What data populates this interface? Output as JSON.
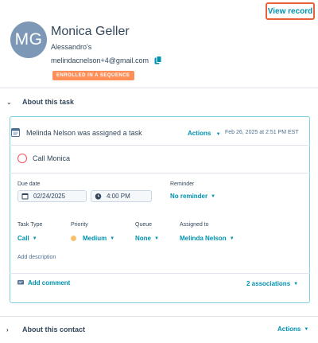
{
  "header": {
    "view_record": "View record",
    "avatar_initials": "MG",
    "name": "Monica Geller",
    "company": "Alessandro's",
    "email": "melindacnelson+4@gmail.com",
    "badge": "ENROLLED IN A SEQUENCE"
  },
  "sections": {
    "task": "About this task",
    "contact": "About this contact",
    "contact_actions": "Actions"
  },
  "task": {
    "assigned_text": "Melinda Nelson was assigned a task",
    "actions": "Actions",
    "timestamp": "Feb 26, 2025 at 2:51 PM EST",
    "title": "Call Monica",
    "due_date_label": "Due date",
    "due_date": "02/24/2025",
    "due_time": "4:00 PM",
    "reminder_label": "Reminder",
    "reminder": "No reminder",
    "task_type_label": "Task Type",
    "task_type": "Call",
    "priority_label": "Priority",
    "priority": "Medium",
    "queue_label": "Queue",
    "queue": "None",
    "assigned_to_label": "Assigned to",
    "assigned_to": "Melinda Nelson",
    "add_description": "Add description",
    "add_comment": "Add comment",
    "associations": "2 associations"
  },
  "colors": {
    "accent": "#0091ae",
    "highlight_border": "#e8613a",
    "badge_bg": "#ff8f59",
    "avatar_bg": "#7c98b6",
    "card_border": "#7fd1de",
    "status_circle": "#f2545b",
    "priority_medium": "#f5c26b"
  }
}
